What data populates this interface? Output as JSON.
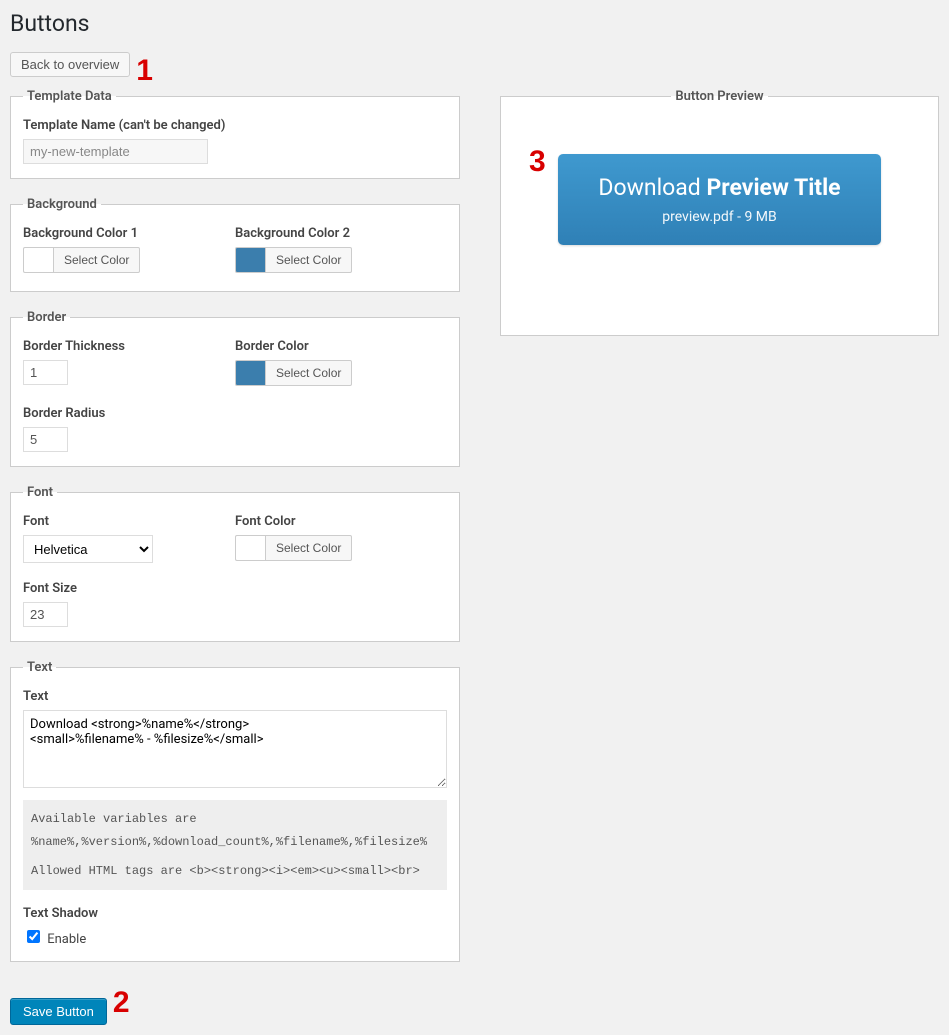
{
  "page_title": "Buttons",
  "back_button": "Back to overview",
  "save_button": "Save Button",
  "annotations": {
    "a1": "1",
    "a2": "2",
    "a3": "3"
  },
  "template_data": {
    "legend": "Template Data",
    "name_label": "Template Name (can't be changed)",
    "name_value": "my-new-template"
  },
  "background": {
    "legend": "Background",
    "color1_label": "Background Color 1",
    "color2_label": "Background Color 2",
    "select_label": "Select Color",
    "color1": "#4aa6dd",
    "color2": "#3b7ead"
  },
  "border": {
    "legend": "Border",
    "thickness_label": "Border Thickness",
    "thickness_value": "1",
    "color_label": "Border Color",
    "color": "#3b7ead",
    "select_label": "Select Color",
    "radius_label": "Border Radius",
    "radius_value": "5"
  },
  "font": {
    "legend": "Font",
    "font_label": "Font",
    "font_value": "Helvetica",
    "color_label": "Font Color",
    "color": "#ffffff",
    "select_label": "Select Color",
    "size_label": "Font Size",
    "size_value": "23"
  },
  "text": {
    "legend": "Text",
    "text_label": "Text",
    "text_value": "Download <strong>%name%</strong>\n<small>%filename% - %filesize%</small>",
    "hint1": "Available variables are %name%,%version%,%download_count%,%filename%,%filesize%",
    "hint2": "Allowed HTML tags are <b><strong><i><em><u><small><br>",
    "shadow_label": "Text Shadow",
    "enable_label": "Enable",
    "shadow_enabled": true
  },
  "preview": {
    "legend": "Button Preview",
    "main_pre": "Download ",
    "main_strong": "Preview Title",
    "sub": "preview.pdf - 9 MB"
  }
}
